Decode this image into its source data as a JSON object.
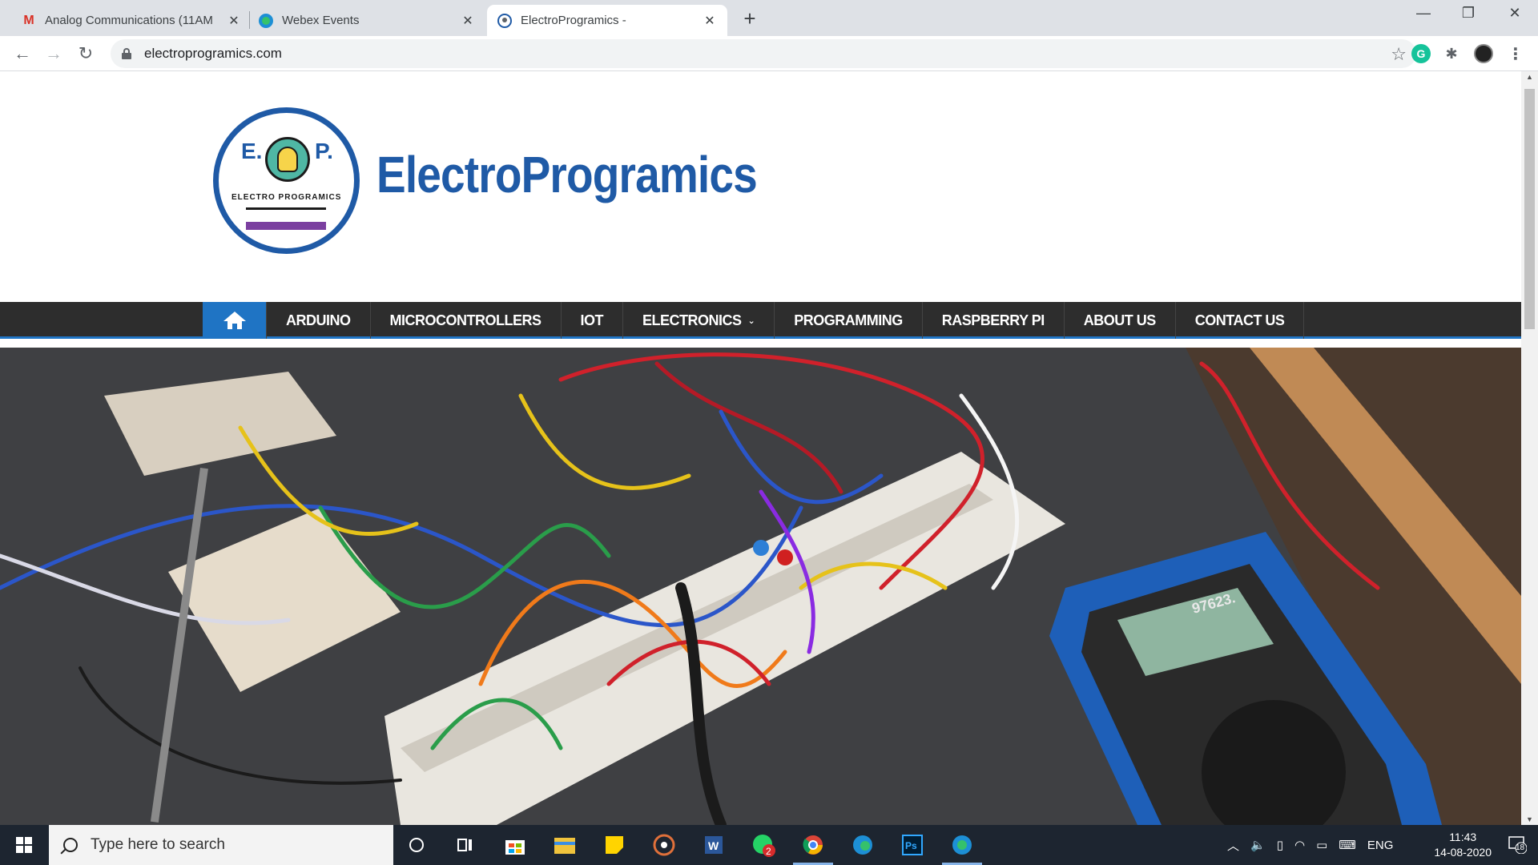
{
  "browser": {
    "tabs": [
      {
        "title": "Analog Communications (11AM",
        "favicon": "gmail-icon",
        "active": false
      },
      {
        "title": "Webex Events",
        "favicon": "webex-icon",
        "active": false
      },
      {
        "title": "ElectroProgramics -",
        "favicon": "site-icon",
        "active": true
      }
    ],
    "url": "electroprogramics.com"
  },
  "site": {
    "logo_letters_e": "E.",
    "logo_letters_p": "P.",
    "logo_ring_text": "ELECTRO PROGRAMICS",
    "brand": "ElectroProgramics",
    "nav": [
      {
        "label": "ARDUINO"
      },
      {
        "label": "MICROCONTROLLERS"
      },
      {
        "label": "IOT"
      },
      {
        "label": "ELECTRONICS",
        "dropdown": true
      },
      {
        "label": "PROGRAMMING"
      },
      {
        "label": "RASPBERRY PI"
      },
      {
        "label": "ABOUT US"
      },
      {
        "label": "CONTACT US"
      }
    ],
    "hero_meter_text": "97623."
  },
  "taskbar": {
    "search_placeholder": "Type here to search",
    "whatsapp_badge": "2",
    "language": "ENG",
    "time": "11:43",
    "date": "14-08-2020",
    "notifications": "18"
  },
  "colors": {
    "brand_blue": "#1f5aa6",
    "nav_bg": "#2d2d2d",
    "nav_accent": "#1f74c4"
  }
}
